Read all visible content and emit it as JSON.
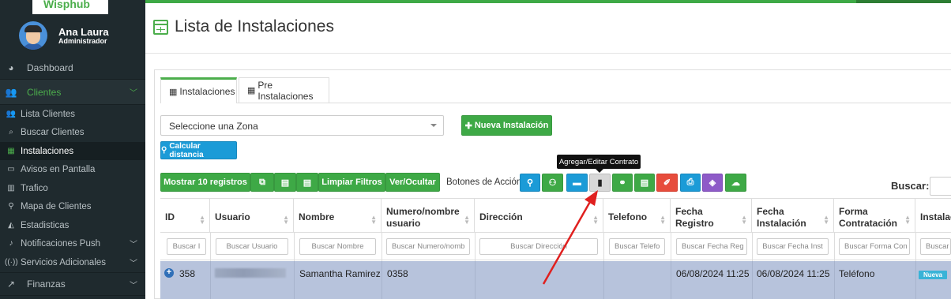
{
  "brand": {
    "logo_text": "Wisphub"
  },
  "user": {
    "name": "Ana Laura",
    "role": "Administrador"
  },
  "sidebar": {
    "items": [
      {
        "label": "Dashboard",
        "icon": "dashboard-icon"
      },
      {
        "label": "Clientes",
        "icon": "users-icon"
      },
      {
        "label": "Lista Clientes",
        "icon": "users-icon"
      },
      {
        "label": "Buscar Clientes",
        "icon": "search-icon"
      },
      {
        "label": "Instalaciones",
        "icon": "calendar-icon"
      },
      {
        "label": "Avisos en Pantalla",
        "icon": "monitor-icon"
      },
      {
        "label": "Trafico",
        "icon": "bar-chart-icon"
      },
      {
        "label": "Mapa de Clientes",
        "icon": "map-marker-icon"
      },
      {
        "label": "Estadisticas",
        "icon": "area-chart-icon"
      },
      {
        "label": "Notificaciones Push",
        "icon": "bell-icon"
      },
      {
        "label": "Servicios Adicionales",
        "icon": "signal-icon"
      },
      {
        "label": "Finanzas",
        "icon": "line-chart-icon"
      }
    ]
  },
  "page": {
    "title": "Lista de Instalaciones"
  },
  "tabs": [
    {
      "label": "Instalaciones",
      "active": true
    },
    {
      "label": "Pre Instalaciones",
      "active": false
    }
  ],
  "filters": {
    "zone_select": "Seleccione una Zona",
    "new_install": "Nueva Instalación",
    "calc_distance": "Calcular distancia"
  },
  "toolbar": {
    "show": "Mostrar 10 registros",
    "clear_filters": "Limpiar Filtros",
    "toggle": "Ver/Ocultar",
    "actions_label": "Botones de Acción:",
    "tooltip": "Agregar/Editar Contrato",
    "search_label": "Buscar:"
  },
  "table": {
    "headers": [
      "ID",
      "Usuario",
      "Nombre",
      "Numero/nombre usuario",
      "Dirección",
      "Telefono",
      "Fecha Registro",
      "Fecha Instalación",
      "Forma Contratación",
      "Instalac"
    ],
    "filters": [
      "Buscar I",
      "Buscar Usuario",
      "Buscar Nombre",
      "Buscar Numero/nomb",
      "Buscar Dirección",
      "Buscar Telefo",
      "Buscar Fecha Reg",
      "Buscar Fecha Inst",
      "Buscar Forma Con",
      "Buscar"
    ],
    "row": {
      "id": "358",
      "nombre": "Samantha Ramirez",
      "numero": "0358",
      "fecha_registro": "06/08/2024 11:25",
      "fecha_instalacion": "06/08/2024 11:25",
      "forma": "Teléfono",
      "estado": "Nueva"
    }
  },
  "colors": {
    "accent": "#3ea946",
    "sidebar": "#1f2a2e",
    "row_highlight": "#b7c3dc",
    "annotation_arrow": "#e0201f"
  }
}
